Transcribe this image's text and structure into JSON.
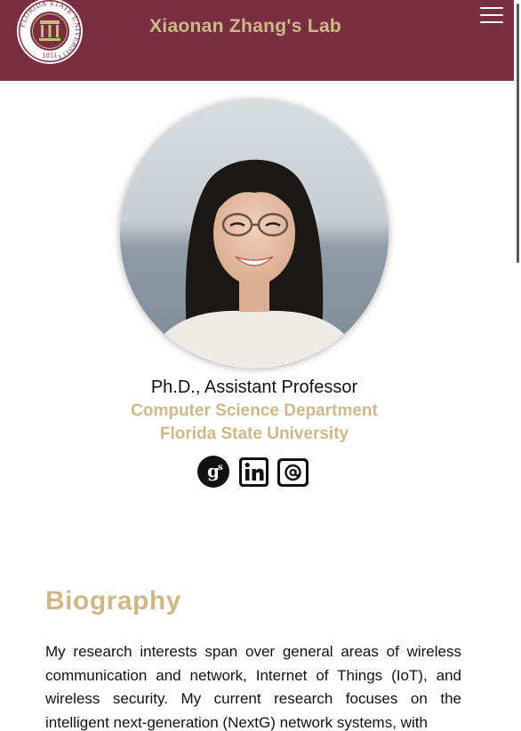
{
  "header": {
    "site_title": "Xiaonan Zhang's Lab",
    "logo_ring_text": "FLORIDA STATE UNIVERSITY",
    "logo_year": "1851",
    "brand_color": "#782f40",
    "accent_color": "#ceb888",
    "menu_icon": "hamburger-menu-icon"
  },
  "profile": {
    "portrait_alt": "Portrait photo",
    "role": "Ph.D., Assistant Professor",
    "department": "Computer Science Department",
    "university": "Florida State University",
    "social_links": [
      {
        "icon": "google-scholar-icon"
      },
      {
        "icon": "linkedin-icon"
      },
      {
        "icon": "email-icon"
      }
    ]
  },
  "biography": {
    "heading": "Biography",
    "text": "My research interests span over general areas of wireless communication and network, Internet of Things (IoT), and wireless security. My current research focuses on the intelligent next-generation (NextG) network systems, with"
  }
}
